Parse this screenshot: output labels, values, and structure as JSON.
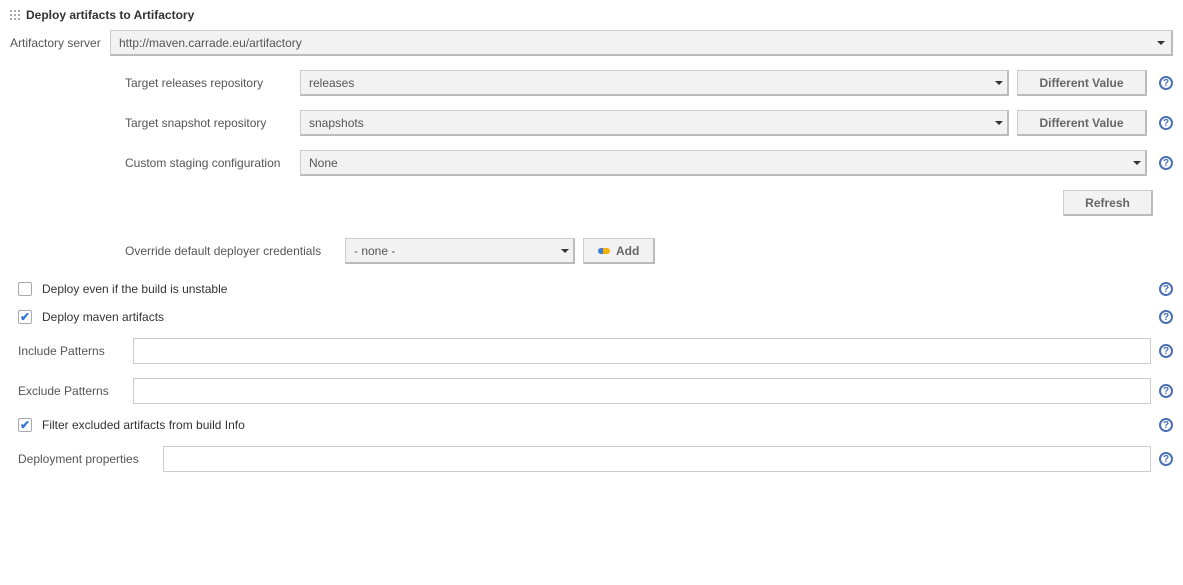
{
  "section_title": "Deploy artifacts to Artifactory",
  "labels": {
    "artifactory_server": "Artifactory server",
    "target_releases": "Target releases repository",
    "target_snapshot": "Target snapshot repository",
    "custom_staging": "Custom staging configuration",
    "override_credentials": "Override default deployer credentials",
    "include_patterns": "Include Patterns",
    "exclude_patterns": "Exclude Patterns",
    "deployment_properties": "Deployment properties"
  },
  "values": {
    "artifactory_server": "http://maven.carrade.eu/artifactory",
    "target_releases": "releases",
    "target_snapshot": "snapshots",
    "custom_staging": "None",
    "credentials": "- none -",
    "include_patterns": "",
    "exclude_patterns": "",
    "deployment_properties": ""
  },
  "buttons": {
    "different_value": "Different Value",
    "refresh": "Refresh",
    "add": "Add"
  },
  "checkboxes": {
    "deploy_unstable": {
      "label": "Deploy even if the build is unstable",
      "checked": false
    },
    "deploy_maven": {
      "label": "Deploy maven artifacts",
      "checked": true
    },
    "filter_excluded": {
      "label": "Filter excluded artifacts from build Info",
      "checked": true
    }
  },
  "help": "?"
}
